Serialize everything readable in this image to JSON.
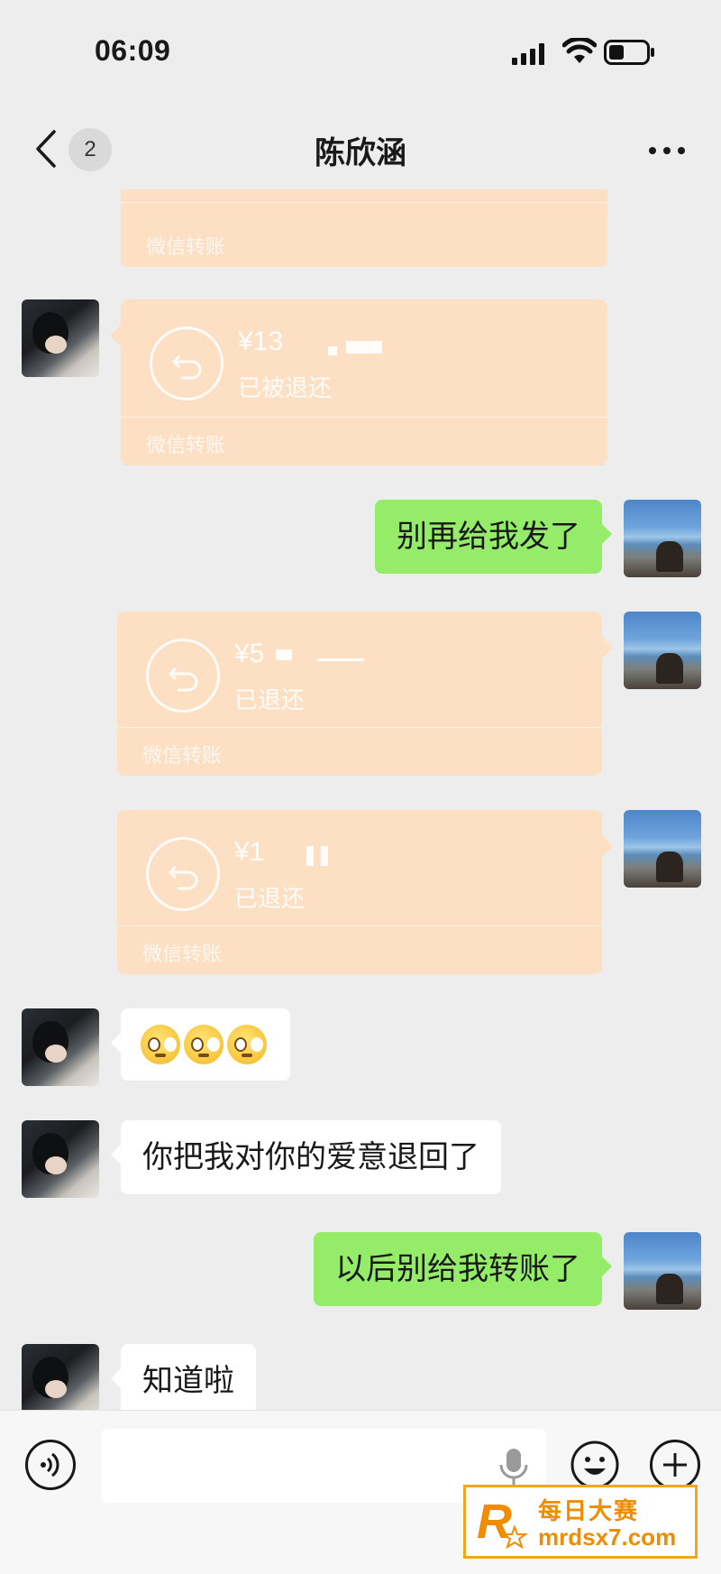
{
  "status_bar": {
    "time": "06:09"
  },
  "header": {
    "title": "陈欣涵",
    "unread_count": "2"
  },
  "messages": [
    {
      "sender": "peer",
      "type": "transfer",
      "amount": "",
      "status": "",
      "label": "微信转账"
    },
    {
      "sender": "peer",
      "type": "transfer",
      "amount": "¥13",
      "status": "已被退还",
      "label": "微信转账"
    },
    {
      "sender": "self",
      "type": "text",
      "text": "别再给我发了"
    },
    {
      "sender": "self",
      "type": "transfer",
      "amount": "¥5",
      "status": "已退还",
      "label": "微信转账"
    },
    {
      "sender": "self",
      "type": "transfer",
      "amount": "¥1",
      "status": "已退还",
      "label": "微信转账"
    },
    {
      "sender": "peer",
      "type": "emoji",
      "emoji": "🥺🥺🥺"
    },
    {
      "sender": "peer",
      "type": "text",
      "text": "你把我对你的爱意退回了"
    },
    {
      "sender": "self",
      "type": "text",
      "text": "以后别给我转账了"
    },
    {
      "sender": "peer",
      "type": "text",
      "text": "知道啦"
    }
  ],
  "input_bar": {
    "placeholder": ""
  },
  "watermark": {
    "title": "每日大赛",
    "domain": "mrdsx7.com"
  },
  "colors": {
    "self_bubble": "#95ec69",
    "peer_bubble": "#ffffff",
    "transfer_faded": "#fde0c4",
    "background": "#ededed",
    "watermark_orange": "#f08c00"
  }
}
